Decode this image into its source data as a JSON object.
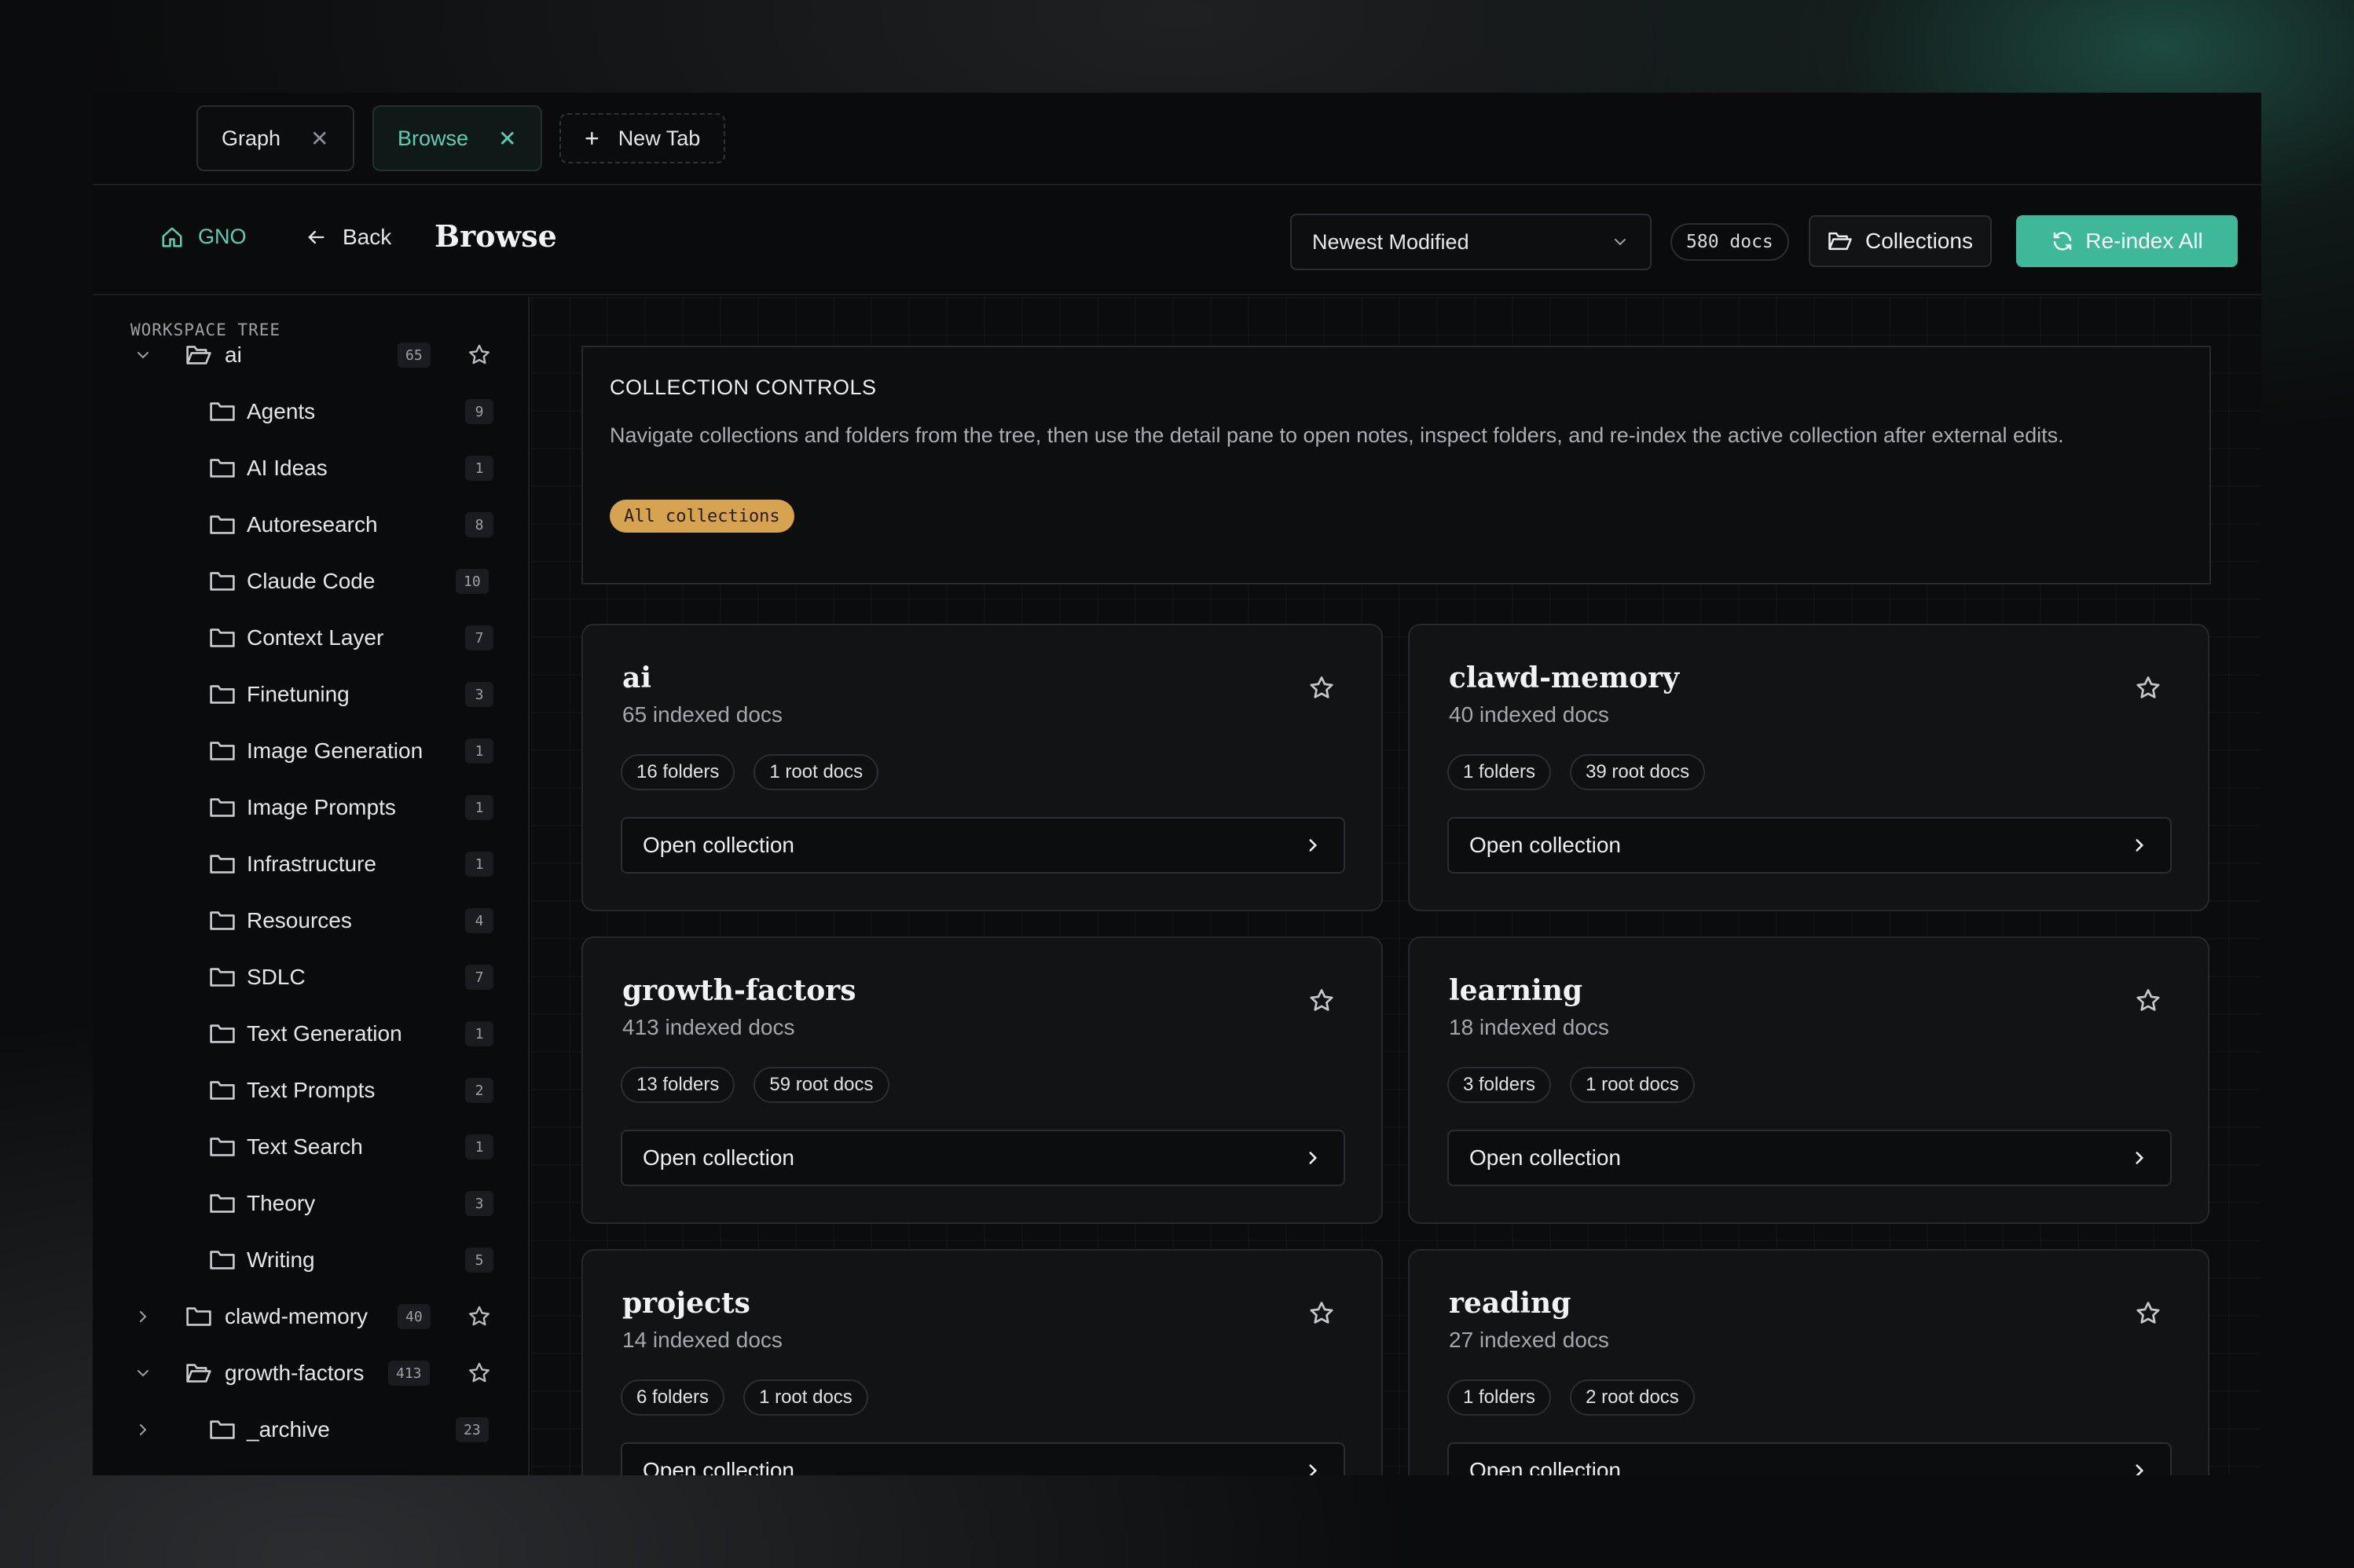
{
  "tabs": [
    {
      "label": "Graph",
      "active": false
    },
    {
      "label": "Browse",
      "active": true
    }
  ],
  "new_tab_label": "New Tab",
  "header": {
    "home_label": "GNO",
    "back_label": "Back",
    "title": "Browse",
    "sort_value": "Newest Modified",
    "docs_count": "580 docs",
    "collections_label": "Collections",
    "reindex_label": "Re-index All"
  },
  "sidebar": {
    "label": "WORKSPACE TREE",
    "root": {
      "name": "ai",
      "count": "65"
    },
    "children": [
      {
        "name": "Agents",
        "count": "9"
      },
      {
        "name": "AI Ideas",
        "count": "1"
      },
      {
        "name": "Autoresearch",
        "count": "8"
      },
      {
        "name": "Claude Code",
        "count": "10"
      },
      {
        "name": "Context Layer",
        "count": "7"
      },
      {
        "name": "Finetuning",
        "count": "3"
      },
      {
        "name": "Image Generation",
        "count": "1"
      },
      {
        "name": "Image Prompts",
        "count": "1"
      },
      {
        "name": "Infrastructure",
        "count": "1"
      },
      {
        "name": "Resources",
        "count": "4"
      },
      {
        "name": "SDLC",
        "count": "7"
      },
      {
        "name": "Text Generation",
        "count": "1"
      },
      {
        "name": "Text Prompts",
        "count": "2"
      },
      {
        "name": "Text Search",
        "count": "1"
      },
      {
        "name": "Theory",
        "count": "3"
      },
      {
        "name": "Writing",
        "count": "5"
      }
    ],
    "others": [
      {
        "name": "clawd-memory",
        "count": "40"
      },
      {
        "name": "growth-factors",
        "count": "413"
      }
    ],
    "archive": {
      "name": "_archive",
      "count": "23"
    },
    "help_glyph": "?"
  },
  "controls": {
    "title": "COLLECTION CONTROLS",
    "description": "Navigate collections and folders from the tree, then use the detail pane to open notes, inspect folders, and re-index the active collection after external edits.",
    "filter_pill": "All collections"
  },
  "open_label": "Open collection",
  "collections": [
    {
      "name": "ai",
      "docs": "65 indexed docs",
      "folders": "16 folders",
      "root_docs": "1 root docs"
    },
    {
      "name": "clawd-memory",
      "docs": "40 indexed docs",
      "folders": "1 folders",
      "root_docs": "39 root docs"
    },
    {
      "name": "growth-factors",
      "docs": "413 indexed docs",
      "folders": "13 folders",
      "root_docs": "59 root docs"
    },
    {
      "name": "learning",
      "docs": "18 indexed docs",
      "folders": "3 folders",
      "root_docs": "1 root docs"
    },
    {
      "name": "projects",
      "docs": "14 indexed docs",
      "folders": "6 folders",
      "root_docs": "1 root docs"
    },
    {
      "name": "reading",
      "docs": "27 indexed docs",
      "folders": "1 folders",
      "root_docs": "2 root docs"
    }
  ],
  "colors": {
    "accent": "#3fb89a",
    "accent_text": "#5ccfb3",
    "pill": "#d6a451"
  },
  "icons": [
    "x-icon",
    "plus-icon",
    "home-icon",
    "arrow-left-icon",
    "chevron-down-icon",
    "folder-icon",
    "folder-open-icon",
    "refresh-icon",
    "star-icon",
    "chevron-right-icon"
  ]
}
